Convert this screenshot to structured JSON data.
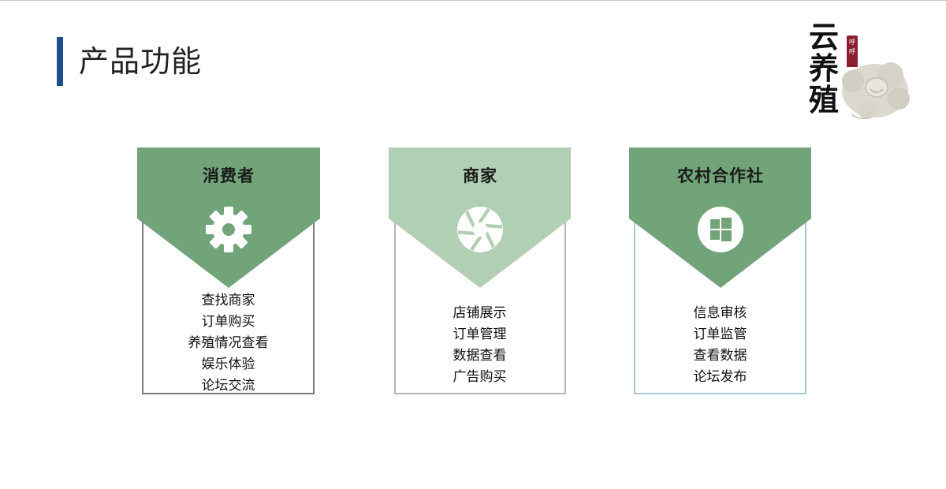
{
  "page": {
    "title": "产品功能"
  },
  "logo": {
    "text_lines": [
      "云",
      "养",
      "殖"
    ],
    "tag_text": "呼呼"
  },
  "colors": {
    "accent_bar": "#1f4e8c",
    "dark_green": "#72a479",
    "light_green": "#b0cfb3"
  },
  "cards": [
    {
      "title": "消费者",
      "icon": "gear-icon",
      "features": [
        "查找商家",
        "订单购买",
        "养殖情况查看",
        "娱乐体验",
        "论坛交流"
      ]
    },
    {
      "title": "商家",
      "icon": "aperture-icon",
      "features": [
        "店铺展示",
        "订单管理",
        "数据查看",
        "广告购买"
      ]
    },
    {
      "title": "农村合作社",
      "icon": "windows-icon",
      "features": [
        "信息审核",
        "订单监管",
        "查看数据",
        "论坛发布"
      ]
    }
  ]
}
